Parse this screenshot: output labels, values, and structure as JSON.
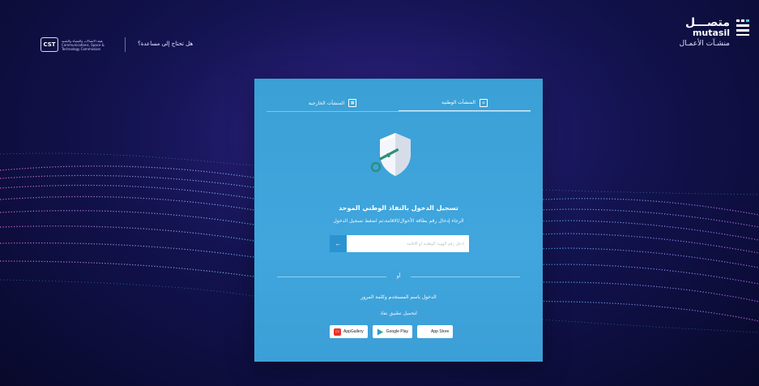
{
  "header": {
    "cst_abbr": "CST",
    "cst_name_ar": "هيئة الاتصالات والفضاء والتقنية",
    "cst_name_en": "Communications, Space & Technology Commission",
    "help_text": "هل تحتاج إلى مساعدة؟",
    "brand_ar": "متصـــل",
    "brand_en": "mutasil",
    "brand_sub": "منشـآت الأعمـال"
  },
  "tabs": [
    {
      "label": "المنشآت الوطنية",
      "icon": "building-icon",
      "active": true
    },
    {
      "label": "المنشآت الخارجية",
      "icon": "globe-building-icon",
      "active": false
    }
  ],
  "login": {
    "title": "تسجيل الدخول بالنفاذ الوطني الموحد",
    "subtitle": "الرجاء إدخال رقم بطاقة الأحوال/الاقامة،ثم اضغط تسجيل الدخول",
    "id_placeholder": "ادخل رقم الهوية الوطنية او الاقامة",
    "id_value": "",
    "submit_glyph": "←",
    "or_text": "أو",
    "alt_login": "الدخول باسم المستخدم وكلمة المرور",
    "download_label": "لتحميل تطبيق نفاذ"
  },
  "stores": [
    {
      "label": "AppGallery",
      "icon": "huawei-appgallery-icon",
      "color": "#e8332b"
    },
    {
      "label": "Google Play",
      "icon": "google-play-icon",
      "color": "#2fb24c"
    },
    {
      "label": "App Store",
      "icon": "apple-icon",
      "color": "#111111"
    }
  ],
  "colors": {
    "card": "#3ea4da",
    "accent": "#2b93d1",
    "background": "#141456"
  }
}
